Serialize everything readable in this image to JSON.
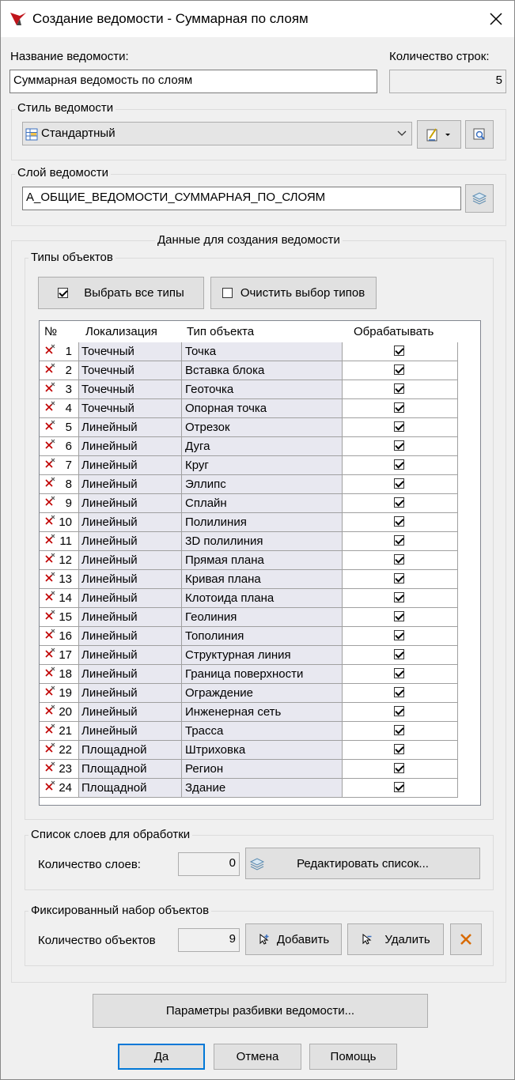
{
  "window": {
    "title": "Создание ведомости - Суммарная по слоям"
  },
  "name_label": "Название ведомости:",
  "name_value": "Суммарная ведомость по слоям",
  "rows_label": "Количество строк:",
  "rows_value": "5",
  "style_group": {
    "title": "Стиль ведомости",
    "value": "Стандартный"
  },
  "layer_group": {
    "title": "Слой ведомости",
    "value": "А_ОБЩИЕ_ВЕДОМОСТИ_СУММАРНАЯ_ПО_СЛОЯМ"
  },
  "data_group": {
    "title": "Данные для создания ведомости"
  },
  "types_group": {
    "title": "Типы объектов",
    "select_all": "Выбрать все типы",
    "clear_all": "Очистить выбор типов",
    "columns": [
      "№",
      "Локализация",
      "Тип объекта",
      "Обрабатывать"
    ],
    "rows": [
      {
        "n": "1",
        "loc": "Точечный",
        "type": "Точка",
        "checked": true
      },
      {
        "n": "2",
        "loc": "Точечный",
        "type": "Вставка блока",
        "checked": true
      },
      {
        "n": "3",
        "loc": "Точечный",
        "type": "Геоточка",
        "checked": true
      },
      {
        "n": "4",
        "loc": "Точечный",
        "type": "Опорная точка",
        "checked": true
      },
      {
        "n": "5",
        "loc": "Линейный",
        "type": "Отрезок",
        "checked": true
      },
      {
        "n": "6",
        "loc": "Линейный",
        "type": "Дуга",
        "checked": true
      },
      {
        "n": "7",
        "loc": "Линейный",
        "type": "Круг",
        "checked": true
      },
      {
        "n": "8",
        "loc": "Линейный",
        "type": "Эллипс",
        "checked": true
      },
      {
        "n": "9",
        "loc": "Линейный",
        "type": "Сплайн",
        "checked": true
      },
      {
        "n": "10",
        "loc": "Линейный",
        "type": "Полилиния",
        "checked": true
      },
      {
        "n": "11",
        "loc": "Линейный",
        "type": "3D полилиния",
        "checked": true
      },
      {
        "n": "12",
        "loc": "Линейный",
        "type": "Прямая плана",
        "checked": true
      },
      {
        "n": "13",
        "loc": "Линейный",
        "type": "Кривая плана",
        "checked": true
      },
      {
        "n": "14",
        "loc": "Линейный",
        "type": "Клотоида плана",
        "checked": true
      },
      {
        "n": "15",
        "loc": "Линейный",
        "type": "Геолиния",
        "checked": true
      },
      {
        "n": "16",
        "loc": "Линейный",
        "type": "Тополиния",
        "checked": true
      },
      {
        "n": "17",
        "loc": "Линейный",
        "type": "Структурная линия",
        "checked": true
      },
      {
        "n": "18",
        "loc": "Линейный",
        "type": "Граница поверхности",
        "checked": true
      },
      {
        "n": "19",
        "loc": "Линейный",
        "type": "Ограждение",
        "checked": true
      },
      {
        "n": "20",
        "loc": "Линейный",
        "type": "Инженерная сеть",
        "checked": true
      },
      {
        "n": "21",
        "loc": "Линейный",
        "type": "Трасса",
        "checked": true
      },
      {
        "n": "22",
        "loc": "Площадной",
        "type": "Штриховка",
        "checked": true
      },
      {
        "n": "23",
        "loc": "Площадной",
        "type": "Регион",
        "checked": true
      },
      {
        "n": "24",
        "loc": "Площадной",
        "type": "Здание",
        "checked": true
      }
    ]
  },
  "layers_group": {
    "title": "Список слоев для обработки",
    "count_label": "Количество слоев:",
    "count_value": "0",
    "edit_button": "Редактировать список..."
  },
  "fixed_group": {
    "title": "Фиксированный набор объектов",
    "count_label": "Количество объектов",
    "count_value": "9",
    "add_button": "Добавить",
    "remove_button": "Удалить"
  },
  "split_button": "Параметры разбивки ведомости...",
  "ok_button": "Да",
  "cancel_button": "Отмена",
  "help_button": "Помощь",
  "colors": {
    "accent": "#0078d7",
    "delete_red": "#c00000",
    "clear_orange": "#d86a00"
  }
}
